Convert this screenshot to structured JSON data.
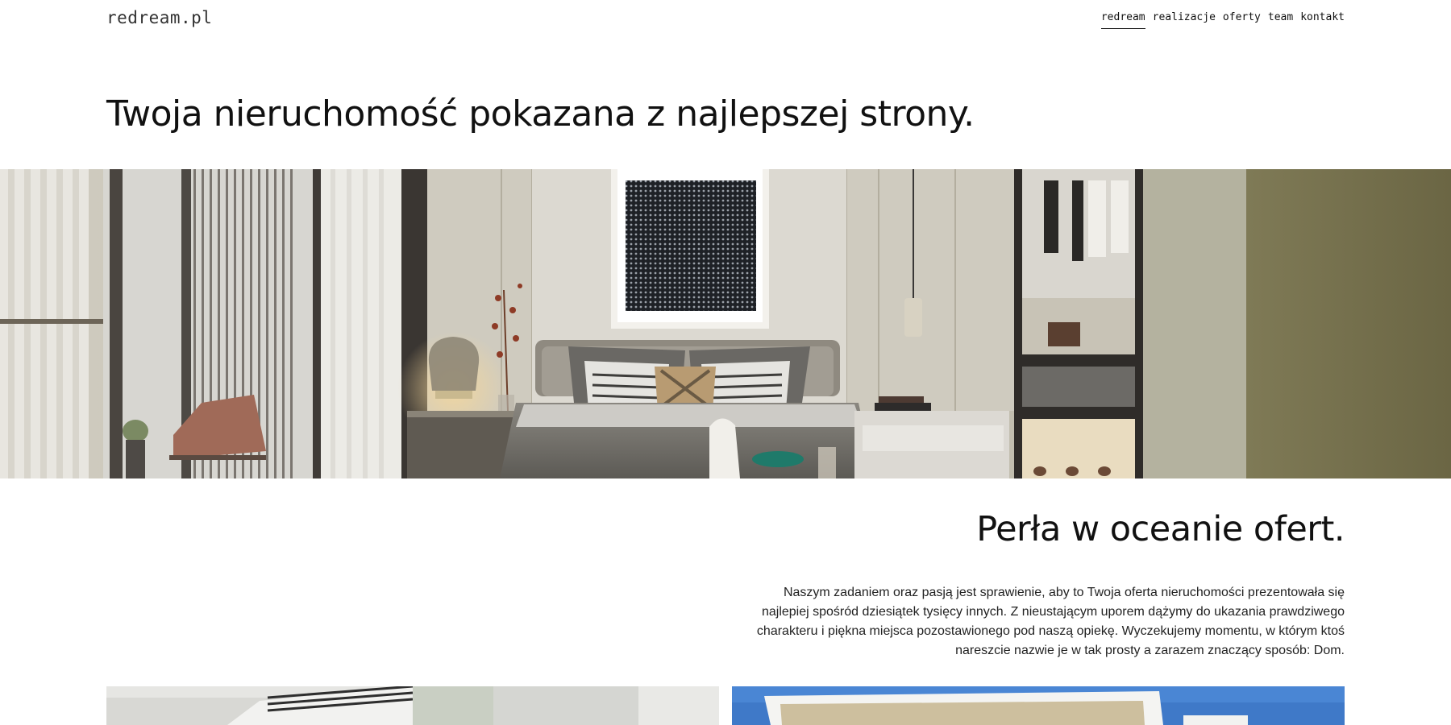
{
  "header": {
    "logo": "redream.pl",
    "nav": [
      {
        "label": "redream",
        "active": true
      },
      {
        "label": "realizacje",
        "active": false
      },
      {
        "label": "oferty",
        "active": false
      },
      {
        "label": "team",
        "active": false
      },
      {
        "label": "kontakt",
        "active": false
      }
    ]
  },
  "hero": {
    "title": "Twoja nieruchomość pokazana z najlepszej strony.",
    "image": "bedroom-interior-photo"
  },
  "about": {
    "title": "Perła w oceanie ofert.",
    "lines": [
      "Naszym zadaniem oraz pasją jest sprawienie, aby to Twoja oferta nieruchomości prezentowała się",
      "najlepiej spośród dziesiątek tysięcy innych. Z nieustającym uporem dążymy do ukazania prawdziwego",
      "charakteru i piękna miejsca pozostawionego pod naszą opiekę. Wyczekujemy momentu, w którym ktoś",
      "nareszcie nazwie je w tak prosty a zarazem znaczący sposób: Dom."
    ]
  },
  "gallery": [
    {
      "image": "interior-staircase-photo"
    },
    {
      "image": "modern-house-exterior-photo"
    }
  ],
  "colors": {
    "text": "#111111",
    "background": "#ffffff",
    "sky": "#3f79c8"
  }
}
